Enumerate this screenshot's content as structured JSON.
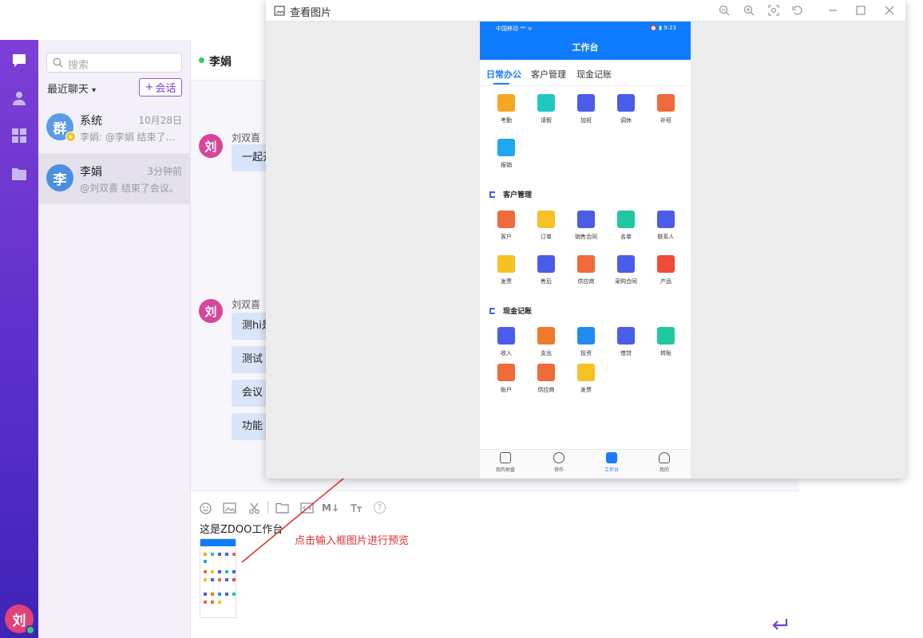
{
  "rail": {
    "me_avatar": "刘"
  },
  "list": {
    "search_placeholder": "搜索",
    "recent_label": "最近聊天",
    "new_chat_label": "会话",
    "conversations": [
      {
        "avatar": "群",
        "name": "系统",
        "time": "10月28日",
        "preview": "李娟: @李娟 结束了…",
        "avatar_color": "#5b9be8"
      },
      {
        "avatar": "李",
        "name": "李娟",
        "time": "3分钟前",
        "preview": "@刘双喜 结束了会议。",
        "avatar_color": "#4a8fe0"
      }
    ]
  },
  "chat": {
    "title": "李娟",
    "messages": [
      {
        "avatar": "刘",
        "sender": "刘双喜",
        "bubbles": [
          "一起开"
        ]
      },
      {
        "avatar": "刘",
        "sender": "刘双喜",
        "bubbles": [
          "测hi是",
          "测试",
          "会议",
          "功能"
        ]
      }
    ],
    "composer": {
      "draft_text": "这是ZDOO工作台",
      "toolbar": [
        "emoji-icon",
        "image-icon",
        "scissors-icon",
        "folder-icon",
        "code-icon",
        "markdown-icon",
        "font-size-icon",
        "help-icon"
      ],
      "markdown_label": "M↓",
      "help_label": "?"
    }
  },
  "annotation": "点击输入框图片进行预览",
  "viewer": {
    "title": "查看图片",
    "phone": {
      "status_left": "中国移动 ⁴⁶ᴵ ᯤ",
      "status_right": "⏰ ▮ 9:23",
      "app_title": "工作台",
      "tabs": [
        "日常办公",
        "客户管理",
        "现金记账"
      ],
      "daily": [
        {
          "label": "考勤",
          "color": "#f5a623"
        },
        {
          "label": "请假",
          "color": "#1fc8c0"
        },
        {
          "label": "加班",
          "color": "#4b5ce8"
        },
        {
          "label": "调休",
          "color": "#4b5ce8"
        },
        {
          "label": "补班",
          "color": "#f06a3a"
        },
        {
          "label": "报销",
          "color": "#1fa8f0"
        }
      ],
      "crm_title": "客户管理",
      "crm": [
        {
          "label": "客户",
          "color": "#f06a3a"
        },
        {
          "label": "订单",
          "color": "#f5c123"
        },
        {
          "label": "销售合同",
          "color": "#4b5ce8"
        },
        {
          "label": "名单",
          "color": "#1fc8a0"
        },
        {
          "label": "联系人",
          "color": "#4b5ce8"
        },
        {
          "label": "发票",
          "color": "#f5c123"
        },
        {
          "label": "售后",
          "color": "#4b5ce8"
        },
        {
          "label": "供应商",
          "color": "#f06a3a"
        },
        {
          "label": "采购合同",
          "color": "#4b5ce8"
        },
        {
          "label": "产品",
          "color": "#f04a3a"
        }
      ],
      "cash_title": "现金记账",
      "cash": [
        {
          "label": "收入",
          "color": "#4b5ce8"
        },
        {
          "label": "支出",
          "color": "#f07a2a"
        },
        {
          "label": "投资",
          "color": "#1f8cf0"
        },
        {
          "label": "借贷",
          "color": "#4b5ce8"
        },
        {
          "label": "转账",
          "color": "#1fc8a0"
        },
        {
          "label": "账户",
          "color": "#f06a3a"
        },
        {
          "label": "供应商",
          "color": "#f06a3a"
        },
        {
          "label": "发票",
          "color": "#f5c123"
        }
      ],
      "nav": [
        "我的地盘",
        "协作",
        "工作台",
        "我的"
      ]
    }
  }
}
